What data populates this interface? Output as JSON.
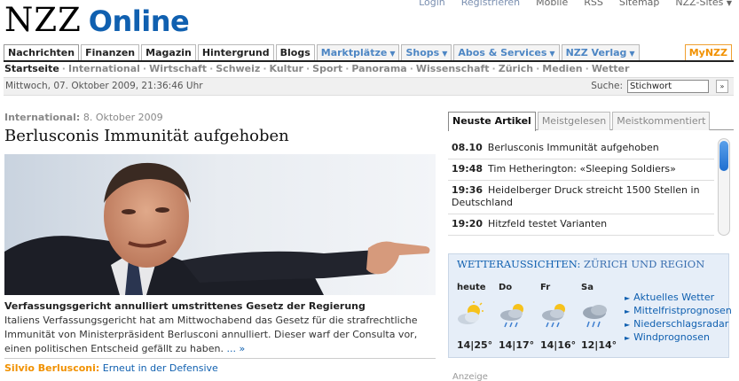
{
  "header": {
    "logo_nzz": "NZZ",
    "logo_online": "Online",
    "top_links": [
      "Login",
      "Registrieren",
      "Mobile",
      "RSS",
      "Sitemap",
      "NZZ-Sites"
    ]
  },
  "mainnav": {
    "tabs": [
      {
        "label": "Nachrichten",
        "style": "active"
      },
      {
        "label": "Finanzen",
        "style": "plain"
      },
      {
        "label": "Magazin",
        "style": "plain"
      },
      {
        "label": "Hintergrund",
        "style": "plain"
      },
      {
        "label": "Blogs",
        "style": "plain"
      },
      {
        "label": "Marktplätze",
        "style": "dropdown"
      },
      {
        "label": "Shops",
        "style": "dropdown"
      },
      {
        "label": "Abos & Services",
        "style": "dropdown"
      },
      {
        "label": "NZZ Verlag",
        "style": "dropdown"
      }
    ],
    "mynzz": "MyNZZ"
  },
  "subnav": {
    "items": [
      "Startseite",
      "International",
      "Wirtschaft",
      "Schweiz",
      "Kultur",
      "Sport",
      "Panorama",
      "Wissenschaft",
      "Zürich",
      "Medien",
      "Wetter"
    ]
  },
  "datebar": {
    "date": "Mittwoch, 07. Oktober 2009, 21:36:46 Uhr",
    "search_label": "Suche:",
    "search_value": "Stichwort",
    "go": "»"
  },
  "article": {
    "kicker_section": "International:",
    "kicker_date": "8. Oktober 2009",
    "headline": "Berlusconis Immunität aufgehoben",
    "lead": "Verfassungsgericht annulliert umstrittenes Gesetz der Regierung",
    "body": "Italiens Verfassungsgericht hat am Mittwochabend das Gesetz für die strafrechtliche Immunität von Ministerpräsident Berlusconi annulliert. Dieser warf der Consulta vor, einen politischen Entscheid gefällt zu haben.",
    "more": "... »",
    "related_who": "Silvio Berlusconi:",
    "related_what": "Erneut in der Defensive"
  },
  "right": {
    "tabs": [
      "Neuste Artikel",
      "Meistgelesen",
      "Meistkommentiert"
    ],
    "news": [
      {
        "time": "08.10",
        "title": "Berlusconis Immunität aufgehoben"
      },
      {
        "time": "19:48",
        "title": "Tim Hetherington: «Sleeping Soldiers»"
      },
      {
        "time": "19:36",
        "title": "Heidelberger Druck streicht 1500 Stellen in Deutschland"
      },
      {
        "time": "19:20",
        "title": "Hitzfeld testet Varianten"
      }
    ]
  },
  "weather": {
    "title": "WETTERAUSSICHTEN:",
    "region": "ZÜRICH UND REGION",
    "days": [
      {
        "day": "heute",
        "temp": "14|25°",
        "icon": "sun-cloud-icon"
      },
      {
        "day": "Do",
        "temp": "14|17°",
        "icon": "sun-cloud-rain-icon"
      },
      {
        "day": "Fr",
        "temp": "14|16°",
        "icon": "sun-cloud-rain-icon"
      },
      {
        "day": "Sa",
        "temp": "12|14°",
        "icon": "cloud-rain-icon"
      }
    ],
    "links": [
      "Aktuelles Wetter",
      "Mittelfristprognosen",
      "Niederschlagsradar",
      "Windprognosen"
    ]
  },
  "anzeige": "Anzeige"
}
